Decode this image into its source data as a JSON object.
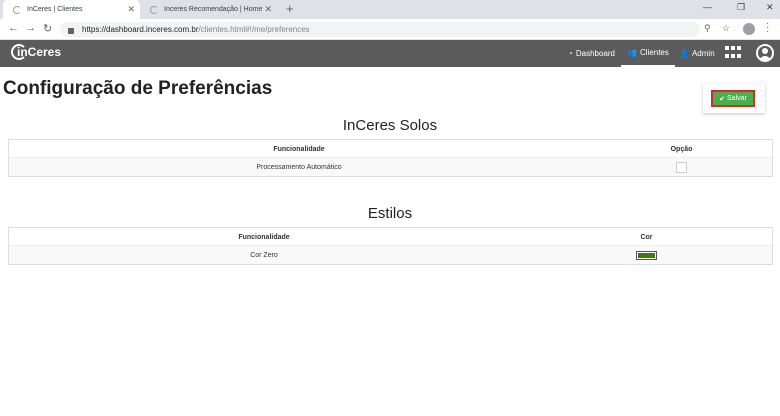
{
  "browser": {
    "tabs": [
      {
        "label": "InCeres | Clientes",
        "active": true
      },
      {
        "label": "Inceres Recomendação | Home",
        "active": false
      }
    ],
    "url_host": "https://dashboard.inceres.com.br",
    "url_path": "/clientes.html#!/me/preferences"
  },
  "navbar": {
    "logo_text": "inCeres",
    "items": [
      {
        "label": "Dashboard",
        "icon": "dashboard-icon"
      },
      {
        "label": "Clientes",
        "icon": "users-icon"
      },
      {
        "label": "Admin",
        "icon": "user-admin-icon"
      }
    ],
    "active_item": "Clientes"
  },
  "page": {
    "title": "Configuração de Preferências",
    "save_label": "Salvar"
  },
  "sections": {
    "solos": {
      "title": "InCeres Solos",
      "col_feature": "Funcionalidade",
      "col_option": "Opção",
      "rows": [
        {
          "feature": "Processamento Automático",
          "checked": false
        }
      ]
    },
    "estilos": {
      "title": "Estilos",
      "col_feature": "Funcionalidade",
      "col_color": "Cor",
      "rows": [
        {
          "feature": "Cor Zero",
          "color": "#3a7d0a"
        }
      ]
    }
  },
  "colors": {
    "navbar_bg": "#5b5b5b",
    "save_button": "#4cae4c",
    "save_border": "#c9302c"
  }
}
